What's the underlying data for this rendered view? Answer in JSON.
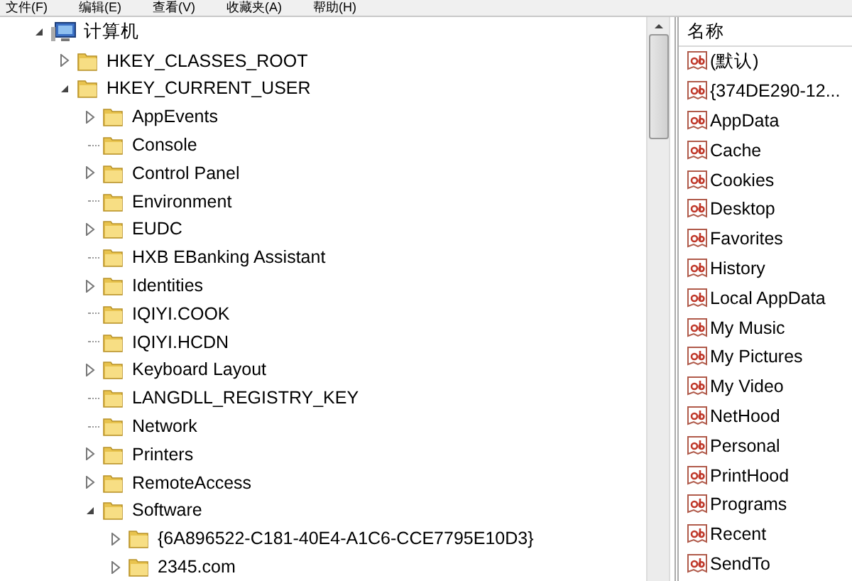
{
  "menu": [
    "文件(F)",
    "编辑(E)",
    "查看(V)",
    "收藏夹(A)",
    "帮助(H)"
  ],
  "tree": [
    {
      "label": "计算机",
      "kind": "computer",
      "expandable": true,
      "expanded": true,
      "children": [
        {
          "label": "HKEY_CLASSES_ROOT",
          "kind": "folder",
          "expandable": true,
          "expanded": false
        },
        {
          "label": "HKEY_CURRENT_USER",
          "kind": "folder",
          "expandable": true,
          "expanded": true,
          "children": [
            {
              "label": "AppEvents",
              "kind": "folder",
              "expandable": true,
              "expanded": false
            },
            {
              "label": "Console",
              "kind": "folder",
              "expandable": false
            },
            {
              "label": "Control Panel",
              "kind": "folder",
              "expandable": true,
              "expanded": false
            },
            {
              "label": "Environment",
              "kind": "folder",
              "expandable": false
            },
            {
              "label": "EUDC",
              "kind": "folder",
              "expandable": true,
              "expanded": false
            },
            {
              "label": "HXB EBanking Assistant",
              "kind": "folder",
              "expandable": false
            },
            {
              "label": "Identities",
              "kind": "folder",
              "expandable": true,
              "expanded": false
            },
            {
              "label": "IQIYI.COOK",
              "kind": "folder",
              "expandable": false
            },
            {
              "label": "IQIYI.HCDN",
              "kind": "folder",
              "expandable": false
            },
            {
              "label": "Keyboard Layout",
              "kind": "folder",
              "expandable": true,
              "expanded": false
            },
            {
              "label": "LANGDLL_REGISTRY_KEY",
              "kind": "folder",
              "expandable": false
            },
            {
              "label": "Network",
              "kind": "folder",
              "expandable": false
            },
            {
              "label": "Printers",
              "kind": "folder",
              "expandable": true,
              "expanded": false
            },
            {
              "label": "RemoteAccess",
              "kind": "folder",
              "expandable": true,
              "expanded": false
            },
            {
              "label": "Software",
              "kind": "folder",
              "expandable": true,
              "expanded": true,
              "children": [
                {
                  "label": "{6A896522-C181-40E4-A1C6-CCE7795E10D3}",
                  "kind": "folder",
                  "expandable": true,
                  "expanded": false
                },
                {
                  "label": "2345.com",
                  "kind": "folder",
                  "expandable": true,
                  "expanded": false
                }
              ]
            }
          ]
        }
      ]
    }
  ],
  "values": {
    "column": "名称",
    "rows": [
      "(默认)",
      "{374DE290-12...",
      "AppData",
      "Cache",
      "Cookies",
      "Desktop",
      "Favorites",
      "History",
      "Local AppData",
      "My Music",
      "My Pictures",
      "My Video",
      "NetHood",
      "Personal",
      "PrintHood",
      "Programs",
      "Recent",
      "SendTo"
    ]
  }
}
